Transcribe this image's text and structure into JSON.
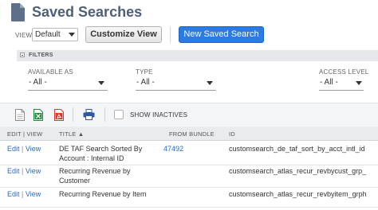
{
  "page": {
    "title": "Saved Searches",
    "icon": "document-icon"
  },
  "view": {
    "label": "VIEW",
    "selected": "Default",
    "customize_label": "Customize View",
    "new_search_label": "New Saved Search"
  },
  "filters": {
    "header": "FILTERS",
    "fields": [
      {
        "label": "AVAILABLE AS",
        "value": "- All -"
      },
      {
        "label": "TYPE",
        "value": "- All -"
      },
      {
        "label": "ACCESS LEVEL",
        "value": "- All -"
      }
    ]
  },
  "toolbar": {
    "icons": [
      "print-icon"
    ],
    "show_inactives_label": "SHOW INACTIVES",
    "show_inactives_checked": false
  },
  "table": {
    "columns": {
      "edit_view": "EDIT | VIEW",
      "title": "TITLE ▲",
      "from_bundle": "FROM BUNDLE",
      "id": "ID"
    },
    "rows": [
      {
        "edit": "Edit",
        "view": "View",
        "title_lines": [
          "DE TAF Search Sorted By",
          "Account : Internal ID"
        ],
        "from_bundle": "47492",
        "id": "customsearch_de_taf_sort_by_acct_intl_id"
      },
      {
        "edit": "Edit",
        "view": "View",
        "title_lines": [
          "Recurring Revenue by",
          "Customer"
        ],
        "from_bundle": "",
        "id": "customsearch_atlas_recur_revbycust_grp_"
      },
      {
        "edit": "Edit",
        "view": "View",
        "title_lines": [
          "Recurring Revenue by Item",
          ""
        ],
        "from_bundle": "",
        "id": "customsearch_atlas_recur_revbyitem_grph"
      }
    ]
  },
  "colors": {
    "title": "#4d5f79",
    "primary_button": "#2e7be0",
    "link": "#2d6bbd",
    "excel_icon": "#1e8a3c",
    "pdf_icon": "#d63b2f",
    "print_icon": "#2a5aa8"
  }
}
